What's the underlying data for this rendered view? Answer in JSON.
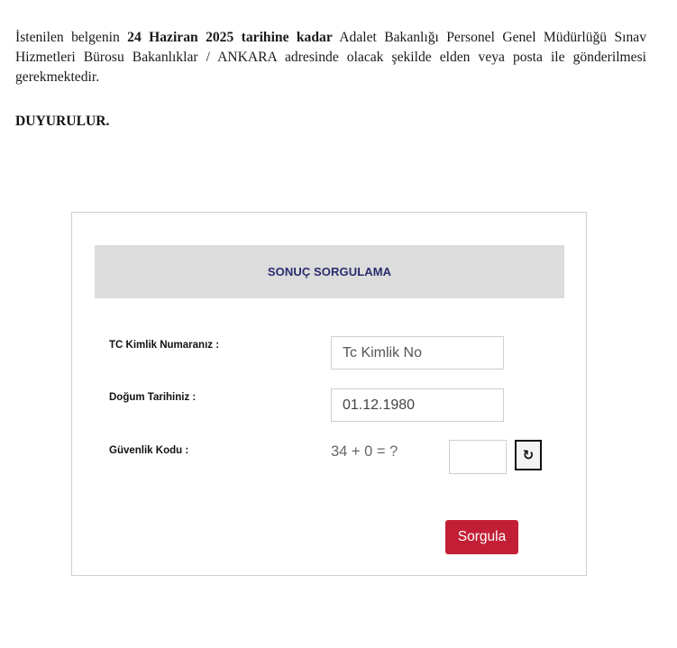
{
  "notice": {
    "before": "İstenilen belgenin ",
    "bold": "24 Haziran 2025 tarihine kadar",
    "after": " Adalet Bakanlığı Personel Genel Müdürlüğü Sınav Hizmetleri Bürosu Bakanlıklar / ANKARA adresinde olacak şekilde elden veya posta ile gönderilmesi gerekmektedir."
  },
  "announcement": "DUYURULUR.",
  "form": {
    "title": "SONUÇ SORGULAMA",
    "tc_label": "TC Kimlik Numaranız :",
    "tc_placeholder": "Tc Kimlik No",
    "tc_value": "",
    "birth_label": "Doğum Tarihiniz :",
    "birth_value": "01.12.1980",
    "security_label": "Güvenlik Kodu :",
    "captcha_question": "34 + 0 = ?",
    "captcha_value": "",
    "refresh_icon": "refresh-icon",
    "submit_label": "Sorgula",
    "submit_color": "#c21f36",
    "header_bg": "#dcdcdc"
  }
}
